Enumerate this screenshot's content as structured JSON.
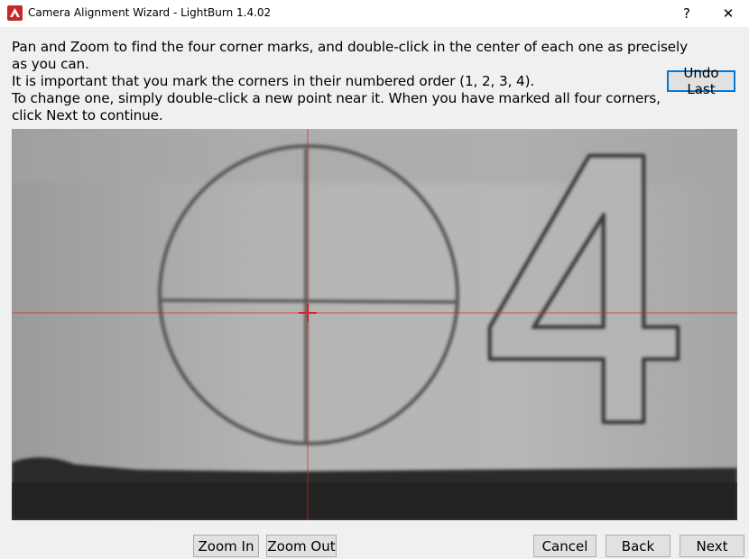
{
  "window": {
    "title": "Camera Alignment Wizard - LightBurn 1.4.02",
    "help_label": "?",
    "close_label": "✕"
  },
  "instructions": {
    "line1": "Pan and Zoom to find the four corner marks, and double-click in the center of each one as precisely",
    "line2": "as you can.",
    "line3": "It is important that you mark the corners in their numbered order (1, 2, 3, 4).",
    "line4": "To change one, simply double-click a new point near it.  When you have marked all four corners,",
    "line5": "click Next to continue."
  },
  "buttons": {
    "undo_last": "Undo Last",
    "zoom_in": "Zoom In",
    "zoom_out": "Zoom Out",
    "cancel": "Cancel",
    "back": "Back",
    "next": "Next"
  },
  "camera": {
    "corner_mark_number": "4",
    "crosshair_color": "#e02020"
  }
}
